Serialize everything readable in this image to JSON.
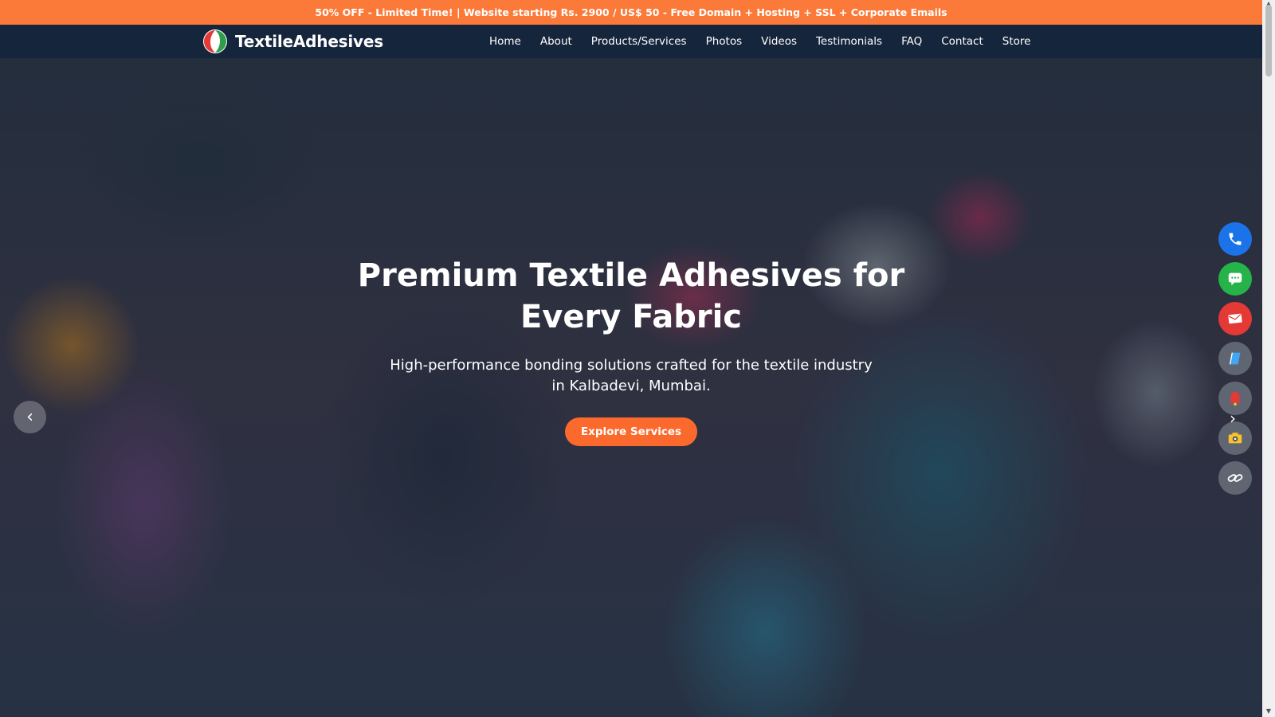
{
  "promo": {
    "text": "50% OFF - Limited Time! | Website starting Rs. 2900 / US$ 50 - Free Domain + Hosting + SSL + Corporate Emails",
    "bg_color": "#fb7a3a"
  },
  "header": {
    "brand": "TextileAdhesives",
    "logo_icon": "red-green-leaf-logo",
    "bg_color": "#15253c",
    "nav": [
      {
        "label": "Home"
      },
      {
        "label": "About"
      },
      {
        "label": "Products/Services"
      },
      {
        "label": "Photos"
      },
      {
        "label": "Videos"
      },
      {
        "label": "Testimonials"
      },
      {
        "label": "FAQ"
      },
      {
        "label": "Contact"
      },
      {
        "label": "Store"
      }
    ]
  },
  "hero": {
    "title": "Premium Textile Adhesives for Every Fabric",
    "subtitle": "High-performance bonding solutions crafted for the textile industry in Kalbadevi, Mumbai.",
    "cta_label": "Explore Services",
    "prev_glyph": "‹",
    "next_glyph": "›",
    "accent_color": "#fb6a2c"
  },
  "floating_actions": [
    {
      "icon": "phone-icon",
      "color": "#1a73e8"
    },
    {
      "icon": "chat-icon",
      "color": "#25b34a"
    },
    {
      "icon": "mail-icon",
      "color": "#e53935"
    },
    {
      "icon": "book-icon",
      "color": "#5f6672"
    },
    {
      "icon": "bell-icon",
      "color": "#5f6672"
    },
    {
      "icon": "camera-icon",
      "color": "#5f6672"
    },
    {
      "icon": "link-icon",
      "color": "#5f6672"
    }
  ]
}
